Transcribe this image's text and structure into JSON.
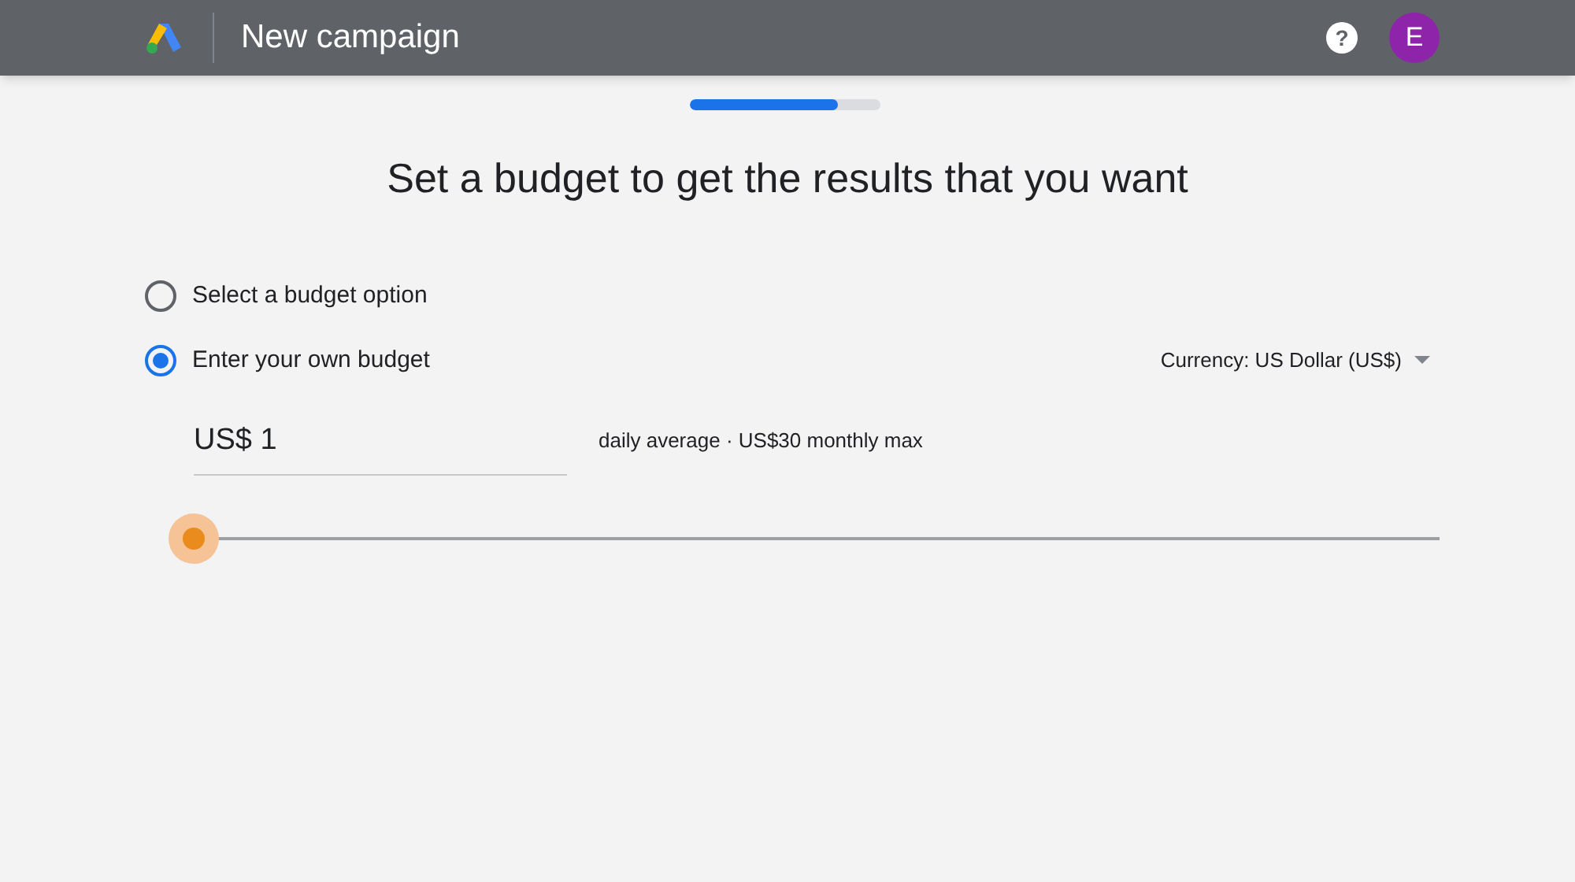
{
  "header": {
    "title": "New campaign",
    "help": "?",
    "avatar": "E"
  },
  "progress": {
    "level": 0.78
  },
  "heading": "Set a budget to get the results that you want",
  "options": [
    {
      "label": "Select a budget option",
      "selected": false
    },
    {
      "label": "Enter your own budget",
      "selected": true
    }
  ],
  "currency": "Currency: US Dollar (US$)",
  "budget": {
    "value": "US$ 1",
    "note": "daily average · US$30 monthly max"
  }
}
